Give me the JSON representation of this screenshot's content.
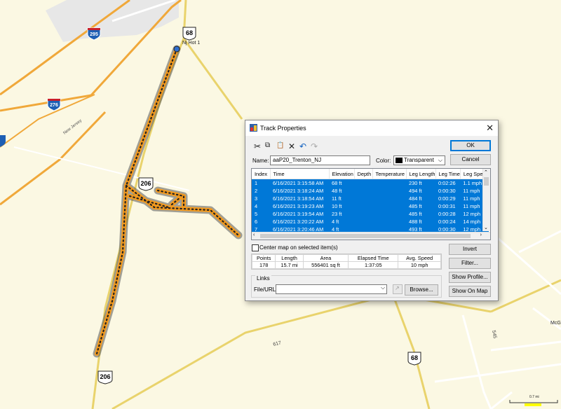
{
  "map": {
    "shields": [
      {
        "type": "interstate",
        "label": "295"
      },
      {
        "type": "interstate",
        "label": "276"
      },
      {
        "type": "us",
        "label": "68"
      },
      {
        "type": "us",
        "label": "206"
      },
      {
        "type": "us",
        "label": "206"
      },
      {
        "type": "us",
        "label": "68"
      }
    ],
    "labels": {
      "nj_hot": "Nj Hot 1",
      "new_jersey": "New Jersey",
      "road_617": "617",
      "road_545": "545",
      "mc": "McG",
      "scale_text": "0.7 mi"
    }
  },
  "dialog": {
    "title": "Track Properties",
    "close_glyph": "✕",
    "toolbar": {
      "cut": "✂",
      "copy": "⧉",
      "paste": "📋",
      "delete": "✕",
      "undo": "↶",
      "redo": "↷"
    },
    "ok_label": "OK",
    "cancel_label": "Cancel",
    "name_label": "Name:",
    "name_value": "aaP20_Trenton_NJ",
    "color_label": "Color:",
    "color_value": "Transparent",
    "color_swatch": "#000000",
    "columns": [
      "Index",
      "Time",
      "Elevation",
      "Depth",
      "Temperature",
      "Leg Length",
      "Leg Time",
      "Leg Speed"
    ],
    "rows": [
      {
        "index": "1",
        "time": "6/16/2021 3:15:58 AM",
        "elevation": "68 ft",
        "depth": "",
        "temperature": "",
        "leg_length": "230 ft",
        "leg_time": "0:02:26",
        "leg_speed": "1.1 mph"
      },
      {
        "index": "2",
        "time": "6/16/2021 3:18:24 AM",
        "elevation": "48 ft",
        "depth": "",
        "temperature": "",
        "leg_length": "494 ft",
        "leg_time": "0:00:30",
        "leg_speed": "11 mph"
      },
      {
        "index": "3",
        "time": "6/16/2021 3:18:54 AM",
        "elevation": "11 ft",
        "depth": "",
        "temperature": "",
        "leg_length": "484 ft",
        "leg_time": "0:00:29",
        "leg_speed": "11 mph"
      },
      {
        "index": "4",
        "time": "6/16/2021 3:19:23 AM",
        "elevation": "10 ft",
        "depth": "",
        "temperature": "",
        "leg_length": "485 ft",
        "leg_time": "0:00:31",
        "leg_speed": "11 mph"
      },
      {
        "index": "5",
        "time": "6/16/2021 3:19:54 AM",
        "elevation": "23 ft",
        "depth": "",
        "temperature": "",
        "leg_length": "485 ft",
        "leg_time": "0:00:28",
        "leg_speed": "12 mph"
      },
      {
        "index": "6",
        "time": "6/16/2021 3:20:22 AM",
        "elevation": "4 ft",
        "depth": "",
        "temperature": "",
        "leg_length": "488 ft",
        "leg_time": "0:00:24",
        "leg_speed": "14 mph"
      },
      {
        "index": "7",
        "time": "6/16/2021 3:20:46 AM",
        "elevation": "4 ft",
        "depth": "",
        "temperature": "",
        "leg_length": "493 ft",
        "leg_time": "0:00:30",
        "leg_speed": "12 mph"
      }
    ],
    "center_map_label": "Center map on selected item(s)",
    "invert_label": "Invert",
    "filter_label": "Filter...",
    "show_profile_label": "Show Profile...",
    "show_on_map_label": "Show On Map",
    "stats_headers": [
      "Points",
      "Length",
      "Area",
      "Elapsed Time",
      "Avg. Speed"
    ],
    "stats_values": [
      "178",
      "15.7 mi",
      "556401 sq ft",
      "1:37:05",
      "10 mph"
    ],
    "links_label": "Links",
    "file_url_label": "File/URL:",
    "file_url_value": "",
    "browse_label": "Browse...",
    "selection_color": "#0078d7",
    "track_color": "#f39a1e"
  }
}
